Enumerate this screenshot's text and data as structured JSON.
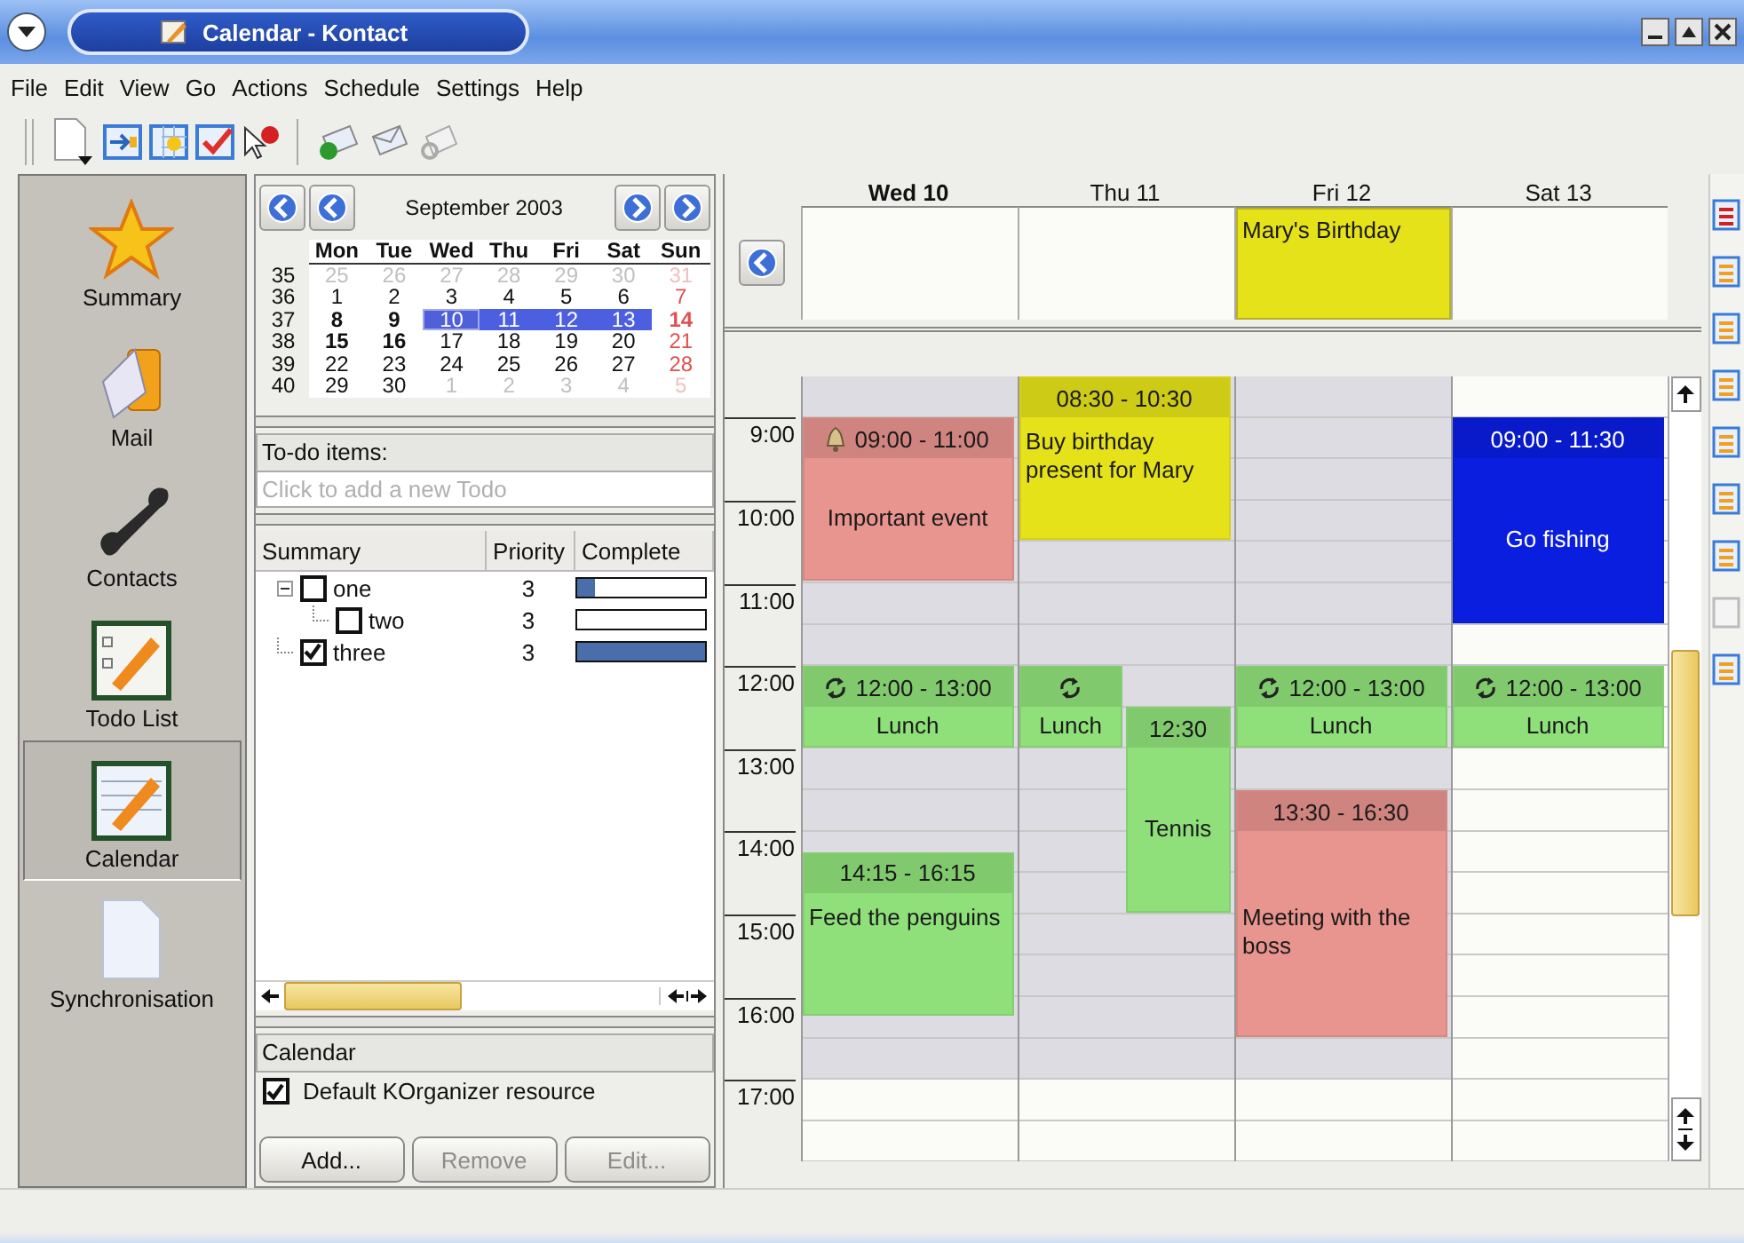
{
  "window": {
    "title": "Calendar - Kontact"
  },
  "menu": [
    "File",
    "Edit",
    "View",
    "Go",
    "Actions",
    "Schedule",
    "Settings",
    "Help"
  ],
  "sidebar": {
    "items": [
      {
        "label": "Summary",
        "selected": false
      },
      {
        "label": "Mail",
        "selected": false
      },
      {
        "label": "Contacts",
        "selected": false
      },
      {
        "label": "Todo List",
        "selected": false
      },
      {
        "label": "Calendar",
        "selected": true
      },
      {
        "label": "Synchronisation",
        "selected": false
      }
    ]
  },
  "mini_calendar": {
    "month": "September 2003",
    "weekdays": [
      "Mon",
      "Tue",
      "Wed",
      "Thu",
      "Fri",
      "Sat",
      "Sun"
    ],
    "weeks": [
      {
        "week": "35",
        "days": [
          {
            "n": "25",
            "muted": true,
            "bold": false,
            "selected": false,
            "today": false
          },
          {
            "n": "26",
            "muted": true,
            "bold": false,
            "selected": false,
            "today": false
          },
          {
            "n": "27",
            "muted": true,
            "bold": false,
            "selected": false,
            "today": false
          },
          {
            "n": "28",
            "muted": true,
            "bold": false,
            "selected": false,
            "today": false
          },
          {
            "n": "29",
            "muted": true,
            "bold": false,
            "selected": false,
            "today": false
          },
          {
            "n": "30",
            "muted": true,
            "bold": false,
            "selected": false,
            "today": false
          },
          {
            "n": "31",
            "muted": true,
            "bold": false,
            "selected": false,
            "today": false
          }
        ]
      },
      {
        "week": "36",
        "days": [
          {
            "n": "1",
            "muted": false,
            "bold": false,
            "selected": false,
            "today": false
          },
          {
            "n": "2",
            "muted": false,
            "bold": false,
            "selected": false,
            "today": false
          },
          {
            "n": "3",
            "muted": false,
            "bold": false,
            "selected": false,
            "today": false
          },
          {
            "n": "4",
            "muted": false,
            "bold": false,
            "selected": false,
            "today": false
          },
          {
            "n": "5",
            "muted": false,
            "bold": false,
            "selected": false,
            "today": false
          },
          {
            "n": "6",
            "muted": false,
            "bold": false,
            "selected": false,
            "today": false
          },
          {
            "n": "7",
            "muted": false,
            "bold": false,
            "selected": false,
            "today": false
          }
        ]
      },
      {
        "week": "37",
        "days": [
          {
            "n": "8",
            "muted": false,
            "bold": true,
            "selected": false,
            "today": false
          },
          {
            "n": "9",
            "muted": false,
            "bold": true,
            "selected": false,
            "today": false
          },
          {
            "n": "10",
            "muted": false,
            "bold": false,
            "selected": true,
            "today": true
          },
          {
            "n": "11",
            "muted": false,
            "bold": false,
            "selected": true,
            "today": false
          },
          {
            "n": "12",
            "muted": false,
            "bold": false,
            "selected": true,
            "today": false
          },
          {
            "n": "13",
            "muted": false,
            "bold": false,
            "selected": true,
            "today": false
          },
          {
            "n": "14",
            "muted": false,
            "bold": true,
            "selected": false,
            "today": false
          }
        ]
      },
      {
        "week": "38",
        "days": [
          {
            "n": "15",
            "muted": false,
            "bold": true,
            "selected": false,
            "today": false
          },
          {
            "n": "16",
            "muted": false,
            "bold": true,
            "selected": false,
            "today": false
          },
          {
            "n": "17",
            "muted": false,
            "bold": false,
            "selected": false,
            "today": false
          },
          {
            "n": "18",
            "muted": false,
            "bold": false,
            "selected": false,
            "today": false
          },
          {
            "n": "19",
            "muted": false,
            "bold": false,
            "selected": false,
            "today": false
          },
          {
            "n": "20",
            "muted": false,
            "bold": false,
            "selected": false,
            "today": false
          },
          {
            "n": "21",
            "muted": false,
            "bold": false,
            "selected": false,
            "today": false
          }
        ]
      },
      {
        "week": "39",
        "days": [
          {
            "n": "22",
            "muted": false,
            "bold": false,
            "selected": false,
            "today": false
          },
          {
            "n": "23",
            "muted": false,
            "bold": false,
            "selected": false,
            "today": false
          },
          {
            "n": "24",
            "muted": false,
            "bold": false,
            "selected": false,
            "today": false
          },
          {
            "n": "25",
            "muted": false,
            "bold": false,
            "selected": false,
            "today": false
          },
          {
            "n": "26",
            "muted": false,
            "bold": false,
            "selected": false,
            "today": false
          },
          {
            "n": "27",
            "muted": false,
            "bold": false,
            "selected": false,
            "today": false
          },
          {
            "n": "28",
            "muted": false,
            "bold": false,
            "selected": false,
            "today": false
          }
        ]
      },
      {
        "week": "40",
        "days": [
          {
            "n": "29",
            "muted": false,
            "bold": false,
            "selected": false,
            "today": false
          },
          {
            "n": "30",
            "muted": false,
            "bold": false,
            "selected": false,
            "today": false
          },
          {
            "n": "1",
            "muted": true,
            "bold": false,
            "selected": false,
            "today": false
          },
          {
            "n": "2",
            "muted": true,
            "bold": false,
            "selected": false,
            "today": false
          },
          {
            "n": "3",
            "muted": true,
            "bold": false,
            "selected": false,
            "today": false
          },
          {
            "n": "4",
            "muted": true,
            "bold": false,
            "selected": false,
            "today": false
          },
          {
            "n": "5",
            "muted": true,
            "bold": false,
            "selected": false,
            "today": false
          }
        ]
      }
    ]
  },
  "todo": {
    "header": "To-do items:",
    "placeholder": "Click to add a new Todo",
    "columns": [
      "Summary",
      "Priority",
      "Complete"
    ],
    "items": [
      {
        "summary": "one",
        "priority": "3",
        "checked": false,
        "level": 0.15,
        "expanded": true,
        "children": [
          {
            "summary": "two",
            "priority": "3",
            "checked": false,
            "level": 0
          }
        ]
      },
      {
        "summary": "three",
        "priority": "3",
        "checked": true,
        "level": 1
      }
    ]
  },
  "resources": {
    "header": "Calendar",
    "items": [
      {
        "label": "Default KOrganizer resource",
        "checked": true
      }
    ],
    "buttons": [
      {
        "label": "Add...",
        "disabled": false
      },
      {
        "label": "Remove",
        "disabled": true
      },
      {
        "label": "Edit...",
        "disabled": true
      }
    ]
  },
  "agenda": {
    "hours": [
      "9:00",
      "10:00",
      "11:00",
      "12:00",
      "13:00",
      "14:00",
      "15:00",
      "16:00",
      "17:00"
    ],
    "days": [
      {
        "label": "Wed 10",
        "today": true,
        "workday": true,
        "events": [
          {
            "time": "09:00 - 11:00",
            "title": "Important event",
            "color": "#e8948f",
            "alarm": true,
            "recurring": false
          },
          {
            "time": "12:00 - 13:00",
            "title": "Lunch",
            "color": "#8fe07a",
            "alarm": false,
            "recurring": true
          },
          {
            "time": "14:15 - 16:15",
            "title": "Feed the penguins",
            "color": "#8fe07a",
            "alarm": false,
            "recurring": false
          }
        ]
      },
      {
        "label": "Thu 11",
        "today": false,
        "workday": true,
        "events": [
          {
            "time": "08:30 - 10:30",
            "title": "Buy birthday present for Mary",
            "color": "#e6e21a",
            "alarm": false,
            "recurring": false
          },
          {
            "title": "Lunch",
            "color": "#8fe07a",
            "alarm": false,
            "recurring": true
          },
          {
            "time": "12:30",
            "title": "Tennis",
            "color": "#8fe07a",
            "alarm": false,
            "recurring": false
          }
        ]
      },
      {
        "label": "Fri 12",
        "today": false,
        "workday": true,
        "all_day": [
          {
            "title": "Mary's Birthday",
            "color": "#e6e21a"
          }
        ],
        "events": [
          {
            "time": "12:00 - 13:00",
            "title": "Lunch",
            "color": "#8fe07a",
            "alarm": false,
            "recurring": true
          },
          {
            "time": "13:30 - 16:30",
            "title": "Meeting with the boss",
            "color": "#e8948f",
            "alarm": false,
            "recurring": false
          }
        ]
      },
      {
        "label": "Sat 13",
        "today": false,
        "workday": false,
        "events": [
          {
            "time": "09:00 - 11:30",
            "title": "Go fishing",
            "color": "#0a1ee0",
            "alarm": false,
            "recurring": false
          },
          {
            "time": "12:00 - 13:00",
            "title": "Lunch",
            "color": "#8fe07a",
            "alarm": false,
            "recurring": true
          }
        ]
      }
    ]
  }
}
